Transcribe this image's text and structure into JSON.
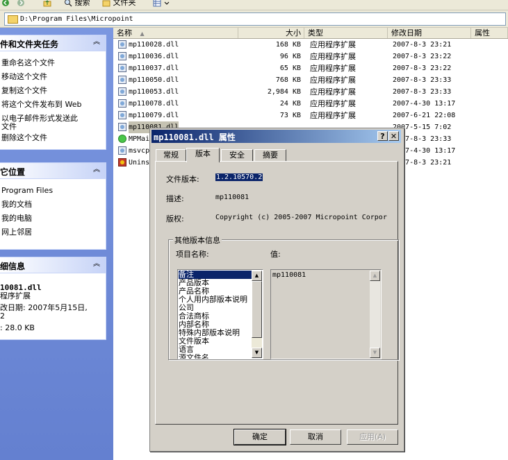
{
  "toolbar": {
    "search_label": "搜索",
    "folders_label": "文件夹"
  },
  "address": {
    "path": "D:\\Program Files\\Micropoint"
  },
  "tasks_panel": {
    "title": "件和文件夹任务",
    "items": [
      "重命名这个文件",
      "移动这个文件",
      "复制这个文件",
      "将这个文件发布到 Web",
      "以电子邮件形式发送此",
      "文件",
      "删除这个文件"
    ]
  },
  "places_panel": {
    "title": "它位置",
    "items": [
      "Program Files",
      "我的文档",
      "我的电脑",
      "网上邻居"
    ]
  },
  "details_panel": {
    "title": "细信息",
    "filename": "10081.dll",
    "type": "程序扩展",
    "modified": "改日期: 2007年5月15日,",
    "modified_cont": "2",
    "size": ": 28.0 KB"
  },
  "columns": {
    "name": "名称",
    "size": "大小",
    "type": "类型",
    "modified": "修改日期",
    "attributes": "属性"
  },
  "files": [
    {
      "name": "mp110028.dll",
      "size": "168 KB",
      "type": "应用程序扩展",
      "date": "2007-8-3 23:21"
    },
    {
      "name": "mp110036.dll",
      "size": "96 KB",
      "type": "应用程序扩展",
      "date": "2007-8-3 23:22"
    },
    {
      "name": "mp110037.dll",
      "size": "65 KB",
      "type": "应用程序扩展",
      "date": "2007-8-3 23:22"
    },
    {
      "name": "mp110050.dll",
      "size": "768 KB",
      "type": "应用程序扩展",
      "date": "2007-8-3 23:33"
    },
    {
      "name": "mp110053.dll",
      "size": "2,984 KB",
      "type": "应用程序扩展",
      "date": "2007-8-3 23:33"
    },
    {
      "name": "mp110078.dll",
      "size": "24 KB",
      "type": "应用程序扩展",
      "date": "2007-4-30 13:17"
    },
    {
      "name": "mp110079.dll",
      "size": "73 KB",
      "type": "应用程序扩展",
      "date": "2007-6-21 22:08"
    },
    {
      "name": "mp110081.dll",
      "size": "",
      "type": "",
      "date": "2007-5-15 7:02"
    },
    {
      "name": "MPMai",
      "size": "",
      "type": "",
      "date": "2007-8-3 23:33"
    },
    {
      "name": "msvcp",
      "size": "",
      "type": "",
      "date": "2007-4-30 13:17"
    },
    {
      "name": "Unins",
      "size": "",
      "type": "",
      "date": "2007-8-3 23:21"
    }
  ],
  "dialog": {
    "title": "mp110081.dll 属性",
    "help_button": "?",
    "close_button": "✕",
    "tabs": [
      "常规",
      "版本",
      "安全",
      "摘要"
    ],
    "active_tab": "版本",
    "file_version_label": "文件版本:",
    "file_version": "1.2.10570.2",
    "description_label": "描述:",
    "description": "mp110081",
    "copyright_label": "版权:",
    "copyright": "Copyright (c) 2005-2007 Micropoint Corpor",
    "other_group_title": "其他版本信息",
    "item_name_label": "项目名称:",
    "value_label": "值:",
    "items": [
      "备注",
      "产品版本",
      "产品名称",
      "个人用内部版本说明",
      "公司",
      "合法商标",
      "内部名称",
      "特殊内部版本说明",
      "文件版本",
      "语言",
      "源文件名"
    ],
    "selected_item": "备注",
    "selected_value": "mp110081",
    "ok_button": "确定",
    "cancel_button": "取消",
    "apply_button": "应用(A)"
  }
}
